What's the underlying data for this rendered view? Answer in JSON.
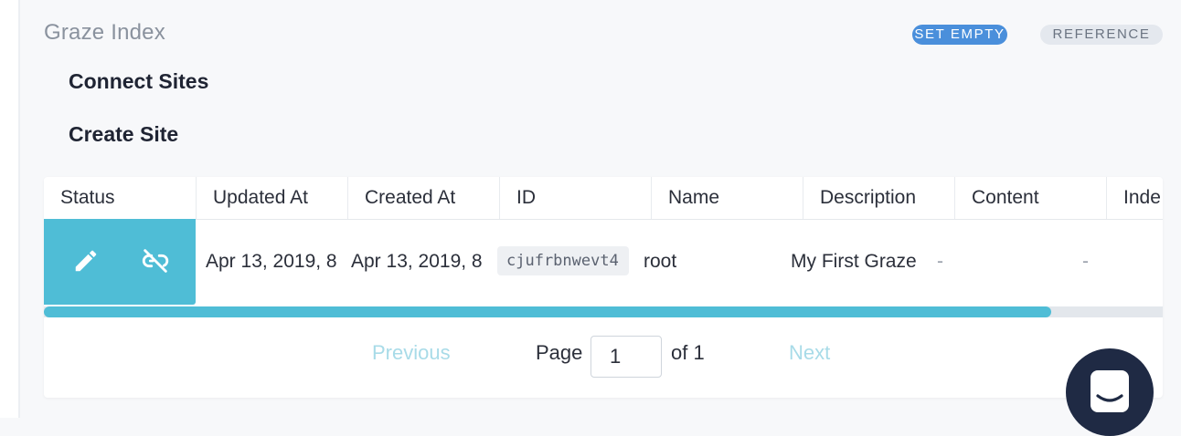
{
  "header": {
    "title": "Graze Index",
    "badges": {
      "set_empty": "SET EMPTY",
      "reference": "REFERENCE"
    }
  },
  "actions": {
    "connect_sites": "Connect Sites",
    "create_site": "Create Site"
  },
  "table": {
    "columns": [
      "Status",
      "Updated At",
      "Created At",
      "ID",
      "Name",
      "Description",
      "Content",
      "Inde"
    ],
    "rows": [
      {
        "updated_at": "Apr 13, 2019, 8",
        "created_at": "Apr 13, 2019, 8",
        "id": "cjufrbnwevt4",
        "name": "root",
        "description": "My First Graze",
        "content": "-",
        "index": "-"
      }
    ],
    "scroll_fraction": 0.9
  },
  "pagination": {
    "previous": "Previous",
    "page_label": "Page",
    "current": "1",
    "of_label": "of 1",
    "next": "Next"
  },
  "icons": {
    "edit": "pencil-icon",
    "unlink": "unlink-icon",
    "chat": "chat-icon"
  },
  "colors": {
    "accent": "#4fbdd6",
    "badge_blue": "#4a8fdb",
    "chat": "#1f2a44"
  }
}
